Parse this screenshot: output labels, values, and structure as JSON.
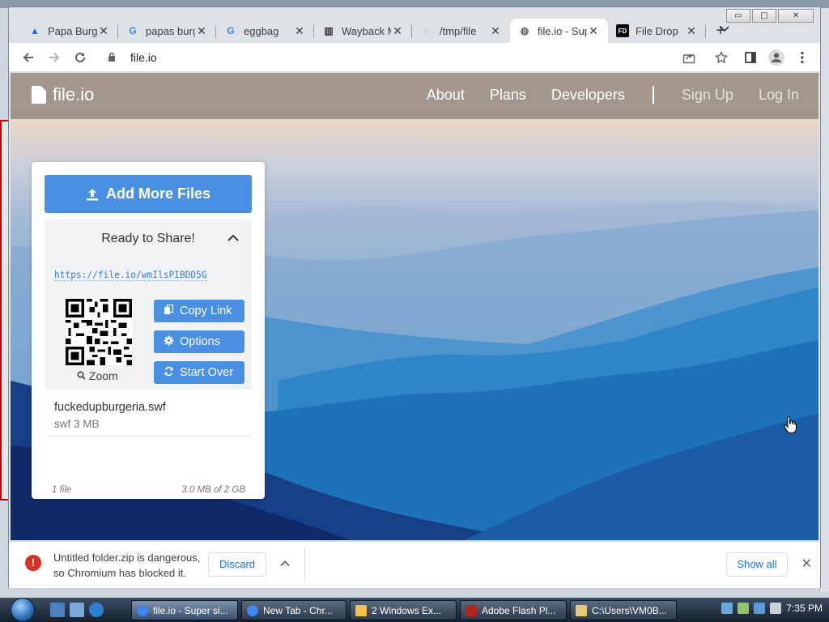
{
  "browser": {
    "window_controls": {
      "minimize": "▭",
      "maximize": "□",
      "close": "✕"
    },
    "tabs": [
      {
        "title": "Papa Burger",
        "favicon": "▲",
        "favicon_color": "#1a73e8",
        "active": false
      },
      {
        "title": "papas burger",
        "favicon": "G",
        "favicon_color": "#4285f4",
        "active": false
      },
      {
        "title": "eggbag",
        "favicon": "G",
        "favicon_color": "#4285f4",
        "active": false
      },
      {
        "title": "Wayback Machine",
        "favicon": "▥",
        "favicon_color": "#333333",
        "active": false
      },
      {
        "title": "/tmp/file",
        "favicon": "◌",
        "favicon_color": "#9aa0a6",
        "active": false
      },
      {
        "title": "file.io - Super simple file sharing",
        "favicon": "◍",
        "favicon_color": "#5f6368",
        "active": true
      },
      {
        "title": "File Drop",
        "favicon": "FD",
        "favicon_color": "#000000",
        "active": false
      }
    ],
    "new_tab": "+",
    "tab_close": "✕",
    "address": "file.io"
  },
  "site": {
    "logo_text": "file.io",
    "nav": {
      "about": "About",
      "plans": "Plans",
      "developers": "Developers",
      "sign_up": "Sign Up",
      "log_in": "Log In"
    },
    "card": {
      "add_button": "Add More Files",
      "status_title": "Ready to Share!",
      "share_url": "https://file.io/wmIlsPIBDD5G",
      "zoom_label": "Zoom",
      "copy_link": "Copy Link",
      "options": "Options",
      "start_over": "Start Over",
      "file_name": "fuckedupburgeria.swf",
      "file_meta": "swf 3 MB",
      "file_count": "1 file",
      "storage": "3.0 MB of 2 GB"
    }
  },
  "download_bar": {
    "message_line1": "Untitled folder.zip is dangerous,",
    "message_line2": "so Chromium has blocked it.",
    "discard": "Discard",
    "show_all": "Show all"
  },
  "taskbar": {
    "items": [
      {
        "label": "file.io - Super si...",
        "active": true,
        "icon_color": "#4285f4"
      },
      {
        "label": "New Tab - Chr...",
        "active": false,
        "icon_color": "#4285f4"
      },
      {
        "label": "2 Windows Ex...",
        "active": false,
        "icon_color": "#f2c14e"
      },
      {
        "label": "Adobe Flash Pl...",
        "active": false,
        "icon_color": "#b3261e"
      },
      {
        "label": "C:\\Users\\VM0B...",
        "active": false,
        "icon_color": "#e6c87a"
      }
    ],
    "clock": "7:35 PM"
  },
  "colors": {
    "accent_blue": "#4a90e2",
    "link_blue": "#3c7bd0",
    "danger_red": "#d93025"
  }
}
